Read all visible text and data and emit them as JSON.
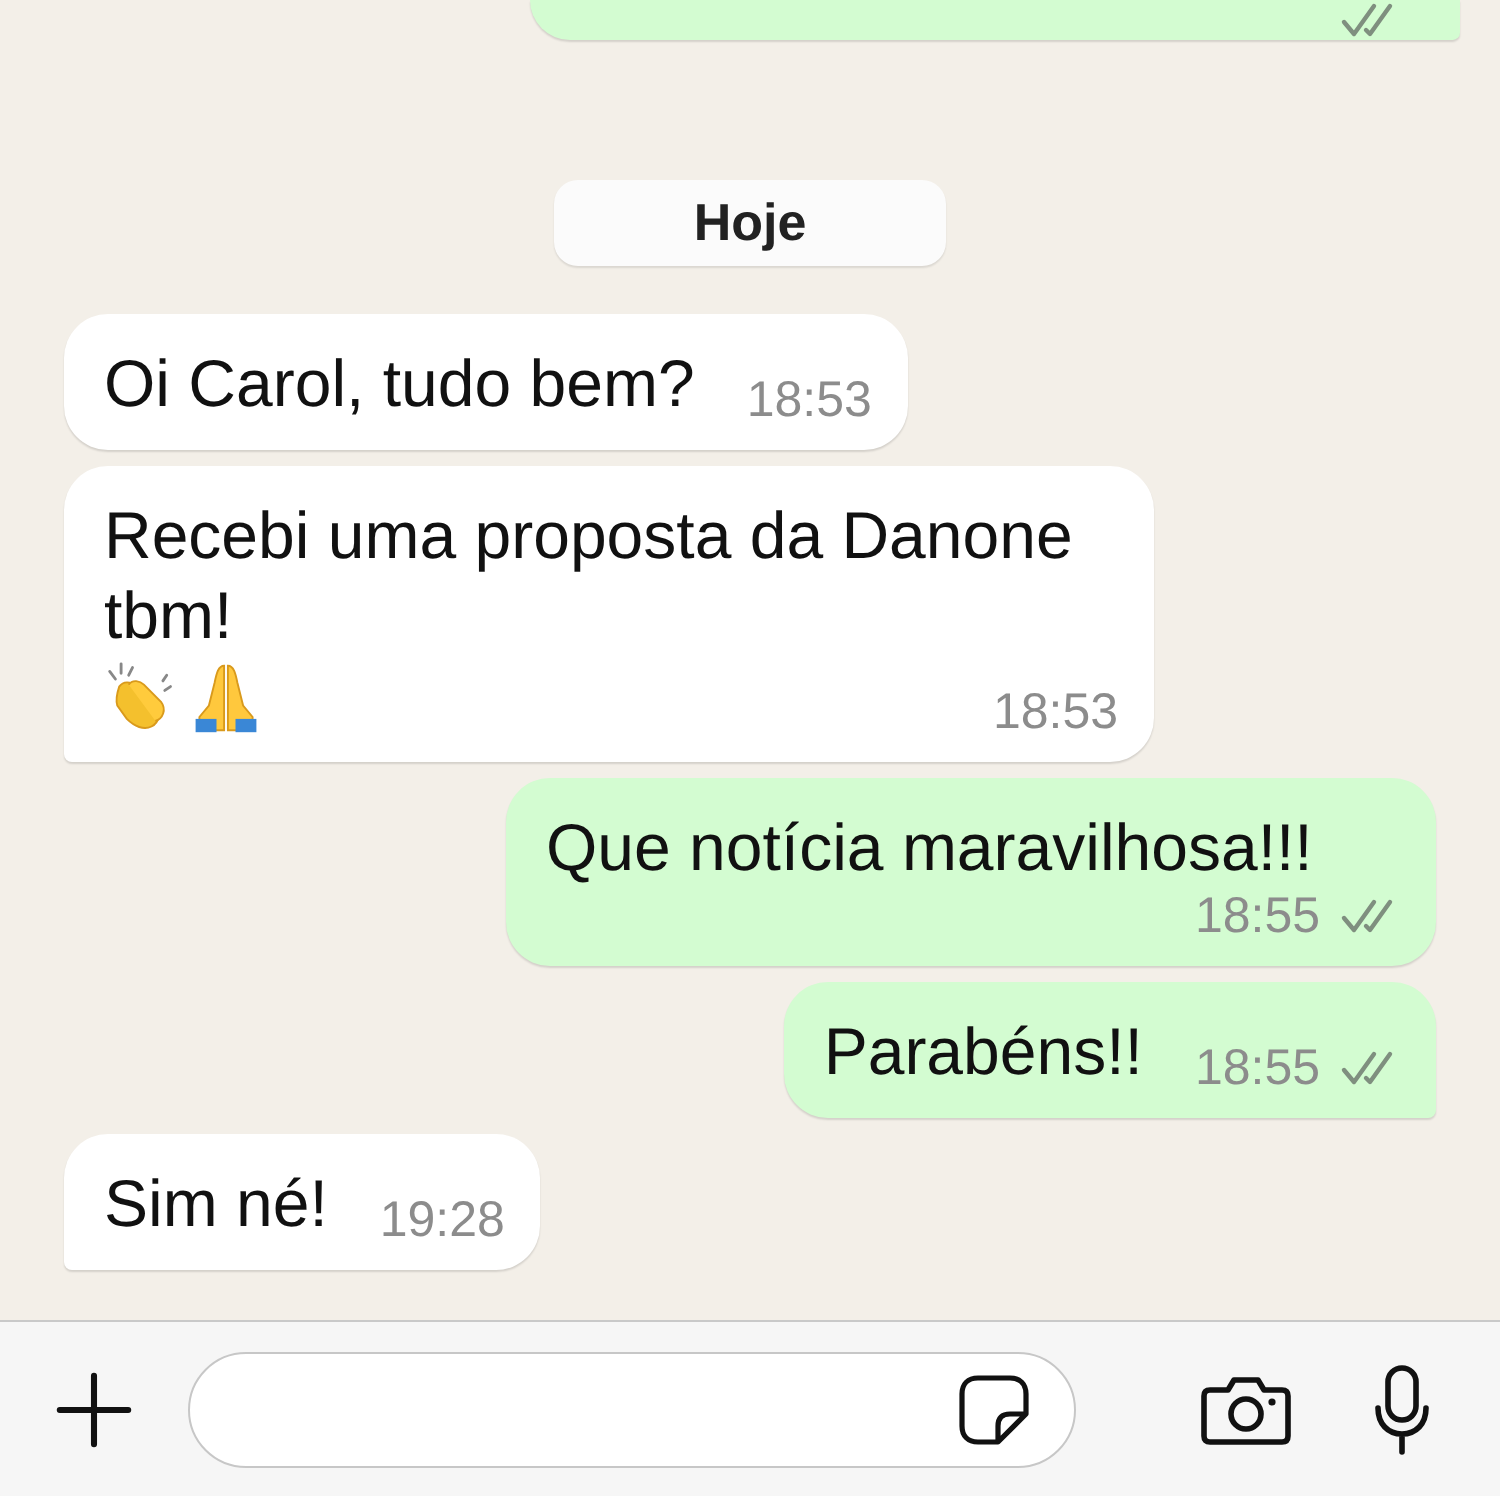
{
  "previous_message": {
    "outgoing": true,
    "read": false
  },
  "date_label": "Hoje",
  "messages": [
    {
      "outgoing": false,
      "text": "Oi Carol, tudo bem?",
      "time": "18:53",
      "tail": false
    },
    {
      "outgoing": false,
      "text": "Recebi uma proposta da Danone tbm!",
      "emoji": [
        {
          "kind": "clapping-hands"
        },
        {
          "kind": "praying-hands"
        }
      ],
      "time": "18:53",
      "tail": true
    },
    {
      "outgoing": true,
      "text": "Que notícia maravilhosa!!!",
      "time": "18:55",
      "read": false,
      "tail": false
    },
    {
      "outgoing": true,
      "text": "Parabéns!!",
      "time": "18:55",
      "read": false,
      "tail": true
    },
    {
      "outgoing": false,
      "text": "Sim né!",
      "time": "19:28",
      "tail": true
    }
  ]
}
